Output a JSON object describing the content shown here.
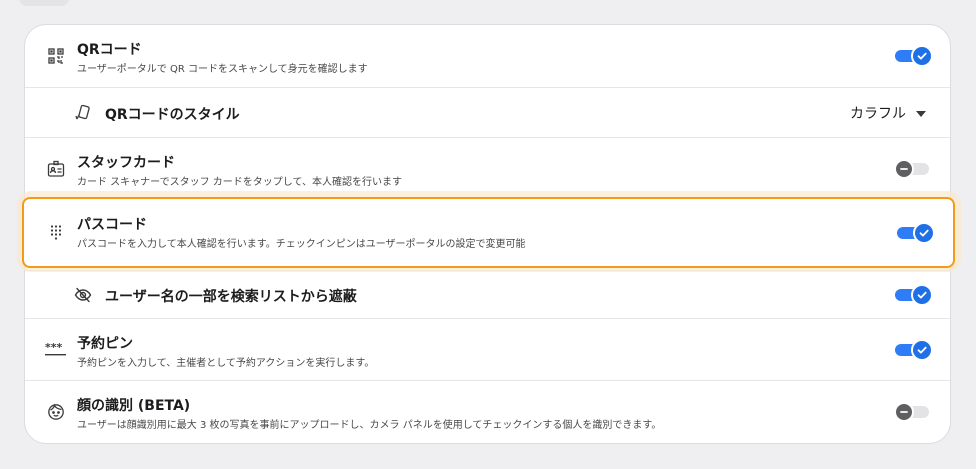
{
  "rows": [
    {
      "title": "QRコード",
      "desc": "ユーザーポータルで QR コードをスキャンして身元を確認します",
      "icon": "qr-code-icon",
      "toggle": "on"
    },
    {
      "title": "QRコードのスタイル",
      "icon": "qr-style-icon",
      "value": "カラフル"
    },
    {
      "title": "スタッフカード",
      "desc": "カード スキャナーでスタッフ カードをタップして、本人確認を行います",
      "icon": "id-badge-icon",
      "toggle": "off"
    },
    {
      "title": "パスコード",
      "desc": "パスコードを入力して本人確認を行います。チェックインピンはユーザーポータルの設定で変更可能",
      "icon": "keypad-icon",
      "toggle": "on"
    },
    {
      "title": "ユーザー名の一部を検索リストから遮蔽",
      "icon": "eye-slash-icon",
      "toggle": "on"
    },
    {
      "title": "予約ピン",
      "desc": "予約ピンを入力して、主催者として予約アクションを実行します。",
      "icon": "pin-dots-icon",
      "toggle": "on"
    },
    {
      "title": "顔の識別 (BETA)",
      "desc": "ユーザーは顔識別用に最大 3 枚の写真を事前にアップロードし、カメラ パネルを使用してチェックインする個人を識別できます。",
      "icon": "face-icon",
      "toggle": "off"
    }
  ],
  "colors": {
    "accent": "#1f6fe6",
    "highlight": "#f39a1b"
  }
}
